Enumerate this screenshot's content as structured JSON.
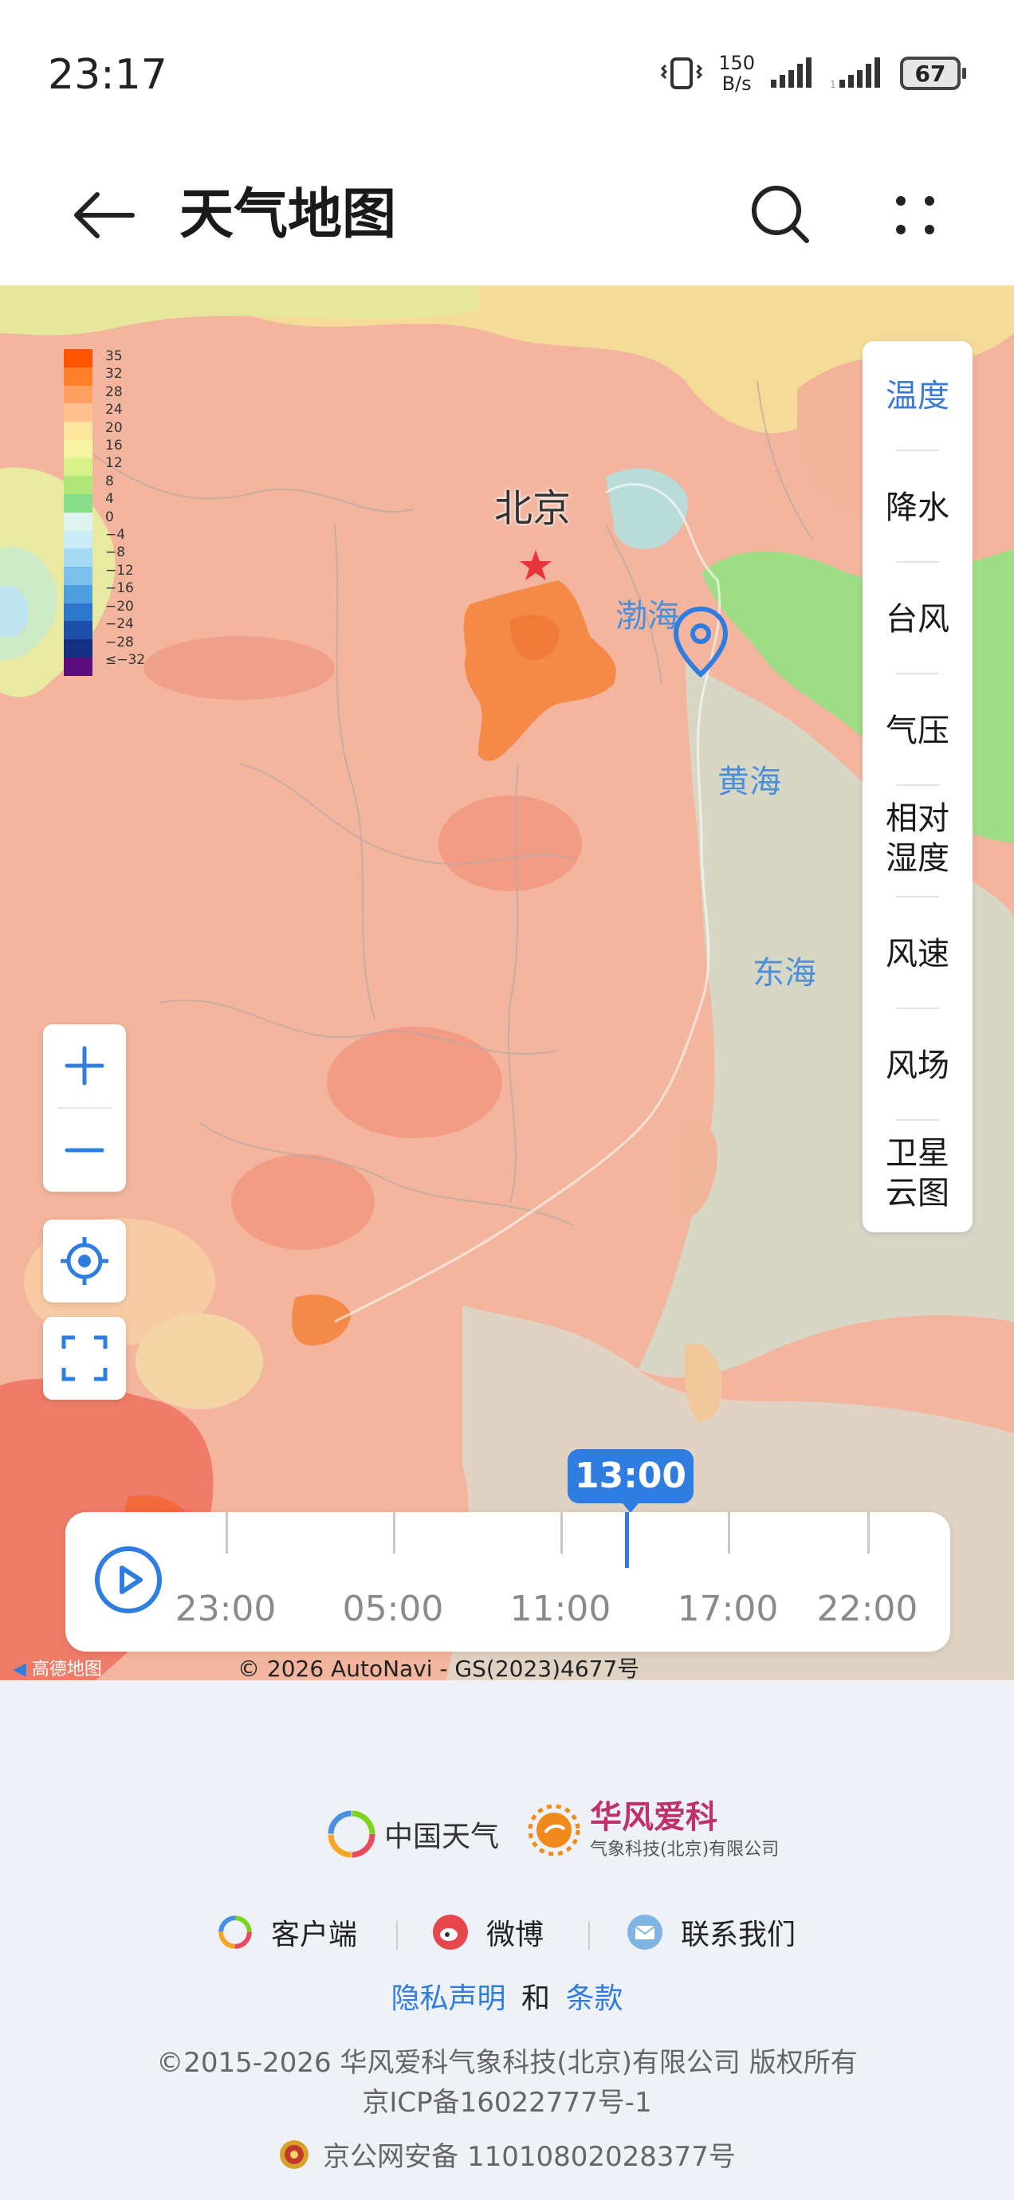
{
  "status_bar": {
    "time": "23:17",
    "net_speed_value": "150",
    "net_speed_unit": "B/s",
    "battery": "67"
  },
  "header": {
    "title": "天气地图",
    "icons": [
      "back-arrow-icon",
      "search-icon",
      "more-icon"
    ]
  },
  "map": {
    "legend_values": [
      "35",
      "32",
      "28",
      "24",
      "20",
      "16",
      "12",
      "8",
      "4",
      "0",
      "−4",
      "−8",
      "−12",
      "−16",
      "−20",
      "−24",
      "−28",
      "≤−32"
    ],
    "legend_colors": [
      "#ff5500",
      "#ff7f2a",
      "#ffa060",
      "#ffc090",
      "#fde6a0",
      "#f3f3a0",
      "#d8f08a",
      "#b0e67a",
      "#88dd88",
      "#dff3ef",
      "#c9ecf6",
      "#a6d9f2",
      "#7cc1ec",
      "#4e9fe0",
      "#2e77cc",
      "#1d4fa8",
      "#162f82",
      "#5c0f7c"
    ],
    "city": "北京",
    "seas": [
      "渤海",
      "黄海",
      "东海"
    ],
    "layers": [
      {
        "label": "温度",
        "active": true
      },
      {
        "label": "降水",
        "active": false
      },
      {
        "label": "台风",
        "active": false
      },
      {
        "label": "气压",
        "active": false
      },
      {
        "label": "相对\n湿度",
        "active": false
      },
      {
        "label": "风速",
        "active": false
      },
      {
        "label": "风场",
        "active": false
      },
      {
        "label": "卫星\n云图",
        "active": false
      }
    ],
    "current_time": "13:00",
    "timeline_labels": [
      "23:00",
      "05:00",
      "11:00",
      "17:00",
      "22:00"
    ],
    "map_provider": "高德地图",
    "copyright": "© 2026 AutoNavi - GS(2023)4677号"
  },
  "footer": {
    "brand1": "中国天气",
    "brand2_name": "华风爱科",
    "brand2_sub": "气象科技(北京)有限公司",
    "links": [
      "客户端",
      "微博",
      "联系我们"
    ],
    "privacy": "隐私声明",
    "and": "和",
    "terms": "条款",
    "copyright": "©2015-2026 华风爱科气象科技(北京)有限公司 版权所有",
    "icp": "京ICP备16022777号-1",
    "police": "京公网安备 11010802028377号"
  },
  "colors": {
    "accent": "#2f7de1",
    "brand_pink": "#c0306a"
  }
}
